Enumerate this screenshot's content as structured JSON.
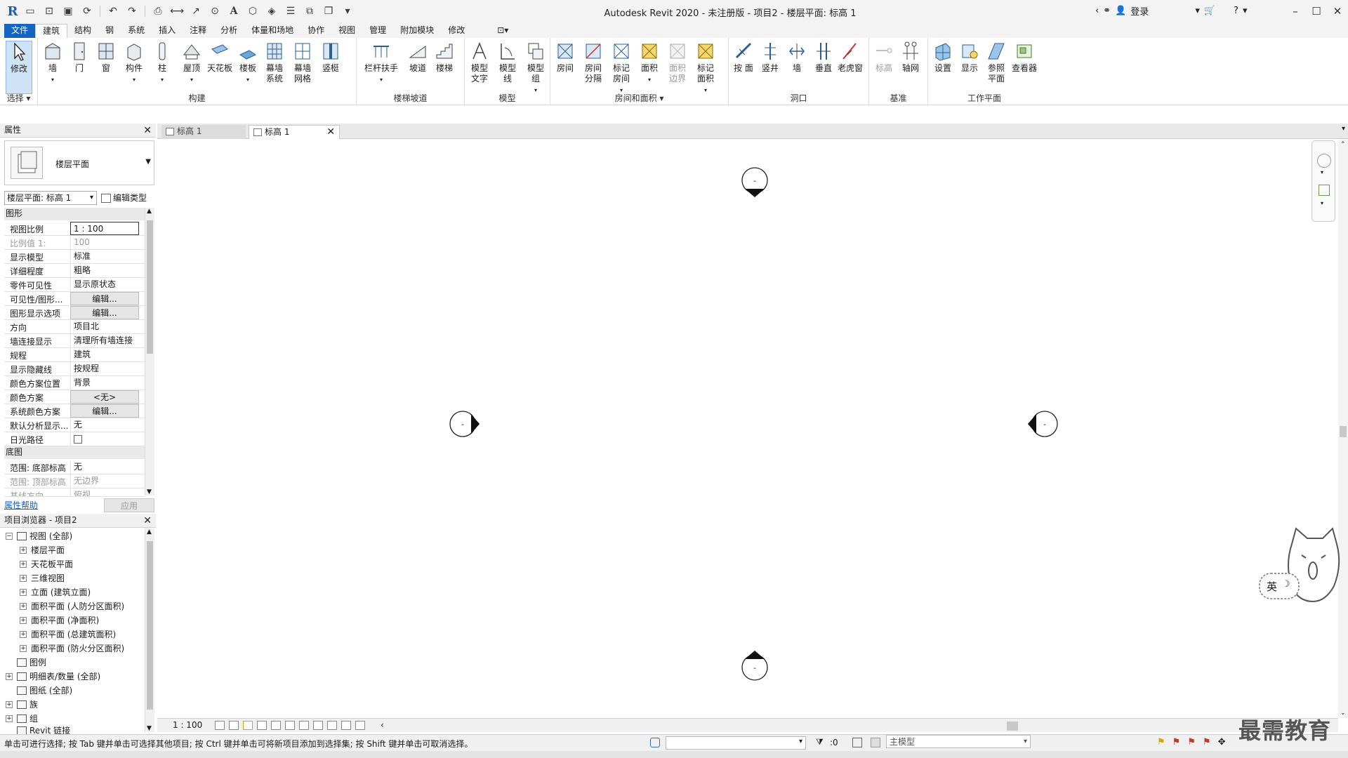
{
  "titlebar": {
    "title": "Autodesk Revit 2020 - 未注册版 - 项目2 - 楼层平面: 标高 1",
    "login": "登录"
  },
  "ribbon_tabs": [
    "文件",
    "建筑",
    "结构",
    "钢",
    "系统",
    "插入",
    "注释",
    "分析",
    "体量和场地",
    "协作",
    "视图",
    "管理",
    "附加模块",
    "修改"
  ],
  "ribbon": {
    "select_label": "修改",
    "select_group": "选择",
    "groups": {
      "build": "构建",
      "stairs": "楼梯坡道",
      "model": "模型",
      "room": "房间和面积",
      "opening": "洞口",
      "datum": "基准",
      "workplane": "工作平面"
    },
    "buttons": {
      "wall": "墙",
      "door": "门",
      "window": "窗",
      "component": "构件",
      "column": "柱",
      "roof": "屋顶",
      "ceiling": "天花板",
      "floor": "楼板",
      "curtain_system": "幕墙 系统",
      "curtain_grid": "幕墙 网格",
      "mullion": "竖梃",
      "railing": "栏杆扶手",
      "ramp": "坡道",
      "stair": "楼梯",
      "model_text": "模型 文字",
      "model_line": "模型 线",
      "model_group": "模型 组",
      "room": "房间",
      "room_sep": "房间 分隔",
      "tag_room": "标记 房间",
      "area": "面积",
      "area_boundary": "面积 边界",
      "tag_area": "标记 面积",
      "by_face": "按 面",
      "shaft": "竖井",
      "wall_opening": "墙",
      "vertical": "垂直",
      "dormer": "老虎窗",
      "level": "标高",
      "grid": "轴网",
      "set": "设置",
      "show": "显示",
      "ref_plane": "参照 平面",
      "viewer": "查看器"
    }
  },
  "properties": {
    "header": "属性",
    "type_name": "楼层平面",
    "instance_select": "楼层平面: 标高 1",
    "edit_type": "编辑类型",
    "cat_graphics": "图形",
    "cat_underlay": "底图",
    "rows": [
      {
        "name": "视图比例",
        "value": "1 : 100"
      },
      {
        "name": "比例值 1:",
        "value": "100"
      },
      {
        "name": "显示模型",
        "value": "标准"
      },
      {
        "name": "详细程度",
        "value": "粗略"
      },
      {
        "name": "零件可见性",
        "value": "显示原状态"
      },
      {
        "name": "可见性/图形...",
        "value": "编辑..."
      },
      {
        "name": "图形显示选项",
        "value": "编辑..."
      },
      {
        "name": "方向",
        "value": "项目北"
      },
      {
        "name": "墙连接显示",
        "value": "清理所有墙连接"
      },
      {
        "name": "规程",
        "value": "建筑"
      },
      {
        "name": "显示隐藏线",
        "value": "按规程"
      },
      {
        "name": "颜色方案位置",
        "value": "背景"
      },
      {
        "name": "颜色方案",
        "value": "<无>"
      },
      {
        "name": "系统颜色方案",
        "value": "编辑..."
      },
      {
        "name": "默认分析显示...",
        "value": "无"
      },
      {
        "name": "日光路径",
        "value": ""
      }
    ],
    "underlay_rows": [
      {
        "name": "范围: 底部标高",
        "value": "无"
      },
      {
        "name": "范围: 顶部标高",
        "value": "无边界"
      },
      {
        "name": "基线方向",
        "value": "俯视"
      }
    ],
    "help_link": "属性帮助",
    "apply": "应用"
  },
  "browser": {
    "header": "项目浏览器 - 项目2",
    "items": [
      {
        "label": "视图 (全部)",
        "level": 0,
        "toggle": "−"
      },
      {
        "label": "楼层平面",
        "level": 1,
        "toggle": "+"
      },
      {
        "label": "天花板平面",
        "level": 1,
        "toggle": "+"
      },
      {
        "label": "三维视图",
        "level": 1,
        "toggle": "+"
      },
      {
        "label": "立面 (建筑立面)",
        "level": 1,
        "toggle": "+"
      },
      {
        "label": "面积平面 (人防分区面积)",
        "level": 1,
        "toggle": "+"
      },
      {
        "label": "面积平面 (净面积)",
        "level": 1,
        "toggle": "+"
      },
      {
        "label": "面积平面 (总建筑面积)",
        "level": 1,
        "toggle": "+"
      },
      {
        "label": "面积平面 (防火分区面积)",
        "level": 1,
        "toggle": "+"
      },
      {
        "label": "图例",
        "level": 0,
        "toggle": ""
      },
      {
        "label": "明细表/数量 (全部)",
        "level": 0,
        "toggle": "+"
      },
      {
        "label": "图纸 (全部)",
        "level": 0,
        "toggle": ""
      },
      {
        "label": "族",
        "level": 0,
        "toggle": "+"
      },
      {
        "label": "组",
        "level": 0,
        "toggle": "+"
      },
      {
        "label": "Revit 链接",
        "level": 0,
        "toggle": ""
      }
    ]
  },
  "view_tabs": {
    "inactive": "标高 1",
    "active": "标高 1"
  },
  "canvas": {
    "marker_text": "-"
  },
  "view_control": {
    "scale": "1 : 100"
  },
  "statusbar": {
    "message": "单击可进行选择; 按 Tab 键并单击可选择其他项目; 按 Ctrl 键并单击可将新项目添加到选择集; 按 Shift 键并单击可取消选择。",
    "zero": ":0",
    "model": "主模型"
  },
  "ime": {
    "label": "英"
  },
  "watermark": "最需教育"
}
